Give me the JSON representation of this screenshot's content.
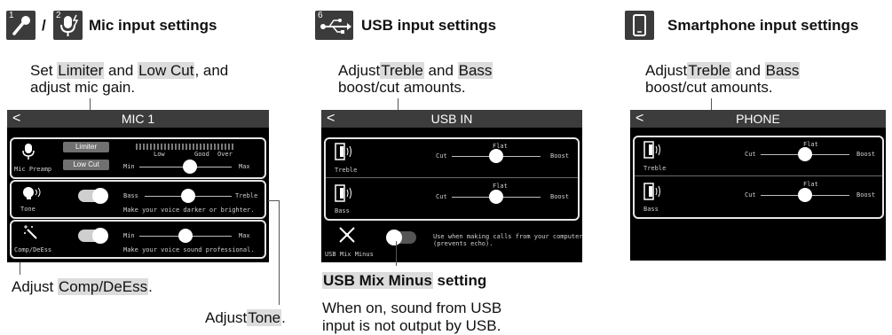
{
  "sections": {
    "mic": {
      "title": "Mic input settings",
      "separator": "/",
      "icon_numbers": [
        "1",
        "2"
      ],
      "icons": [
        "microphone-icon",
        "podcast-mic-icon"
      ],
      "desc_parts": [
        "Set ",
        "Limiter",
        " and ",
        "Low Cut",
        ", and",
        "adjust mic gain."
      ],
      "screen": {
        "title": "MIC 1",
        "back": "<",
        "preamp": {
          "label": "Mic Preamp",
          "limiter": "Limiter",
          "lowcut": "Low Cut",
          "meter_labels": [
            "Low",
            "Good",
            "Over"
          ],
          "min": "Min",
          "max": "Max",
          "gain_position": 0.55
        },
        "tone": {
          "label": "Tone",
          "left": "Bass",
          "right": "Treble",
          "hint": "Make your voice darker or brighter.",
          "toggle": "on",
          "position": 0.5
        },
        "comp": {
          "label": "Comp/DeEss",
          "left": "Min",
          "right": "Max",
          "hint": "Make your voice sound professional.",
          "toggle": "on",
          "position": 0.5
        }
      },
      "callout_comp": [
        "Adjust ",
        "Comp/DeEss",
        "."
      ],
      "callout_tone": [
        "Adjust",
        "Tone",
        "."
      ]
    },
    "usb": {
      "title": "USB input settings",
      "icon_number": "6",
      "icon": "usb-icon",
      "desc_parts": [
        "Adjust",
        "Treble",
        " and ",
        "Bass",
        "boost/cut amounts."
      ],
      "screen": {
        "title": "USB IN",
        "back": "<",
        "rows": [
          {
            "label": "Treble",
            "cut": "Cut",
            "flat": "Flat",
            "boost": "Boost",
            "position": 0.5
          },
          {
            "label": "Bass",
            "cut": "Cut",
            "flat": "Flat",
            "boost": "Boost",
            "position": 0.5
          }
        ],
        "mixminus": {
          "label": "USB Mix Minus",
          "hint_line1": "Use when making calls from your computer",
          "hint_line2": "(prevents echo).",
          "toggle": "off"
        }
      },
      "mixminus_title": "USB Mix Minus",
      "mixminus_title_suffix": " setting",
      "mixminus_desc": [
        "When on, sound from USB",
        "input is not output by USB."
      ]
    },
    "phone": {
      "title": "Smartphone input settings",
      "icon": "smartphone-icon",
      "desc_parts": [
        "Adjust",
        "Treble",
        " and ",
        "Bass",
        "boost/cut amounts."
      ],
      "screen": {
        "title": "PHONE",
        "back": "<",
        "rows": [
          {
            "label": "Treble",
            "cut": "Cut",
            "flat": "Flat",
            "boost": "Boost",
            "position": 0.5
          },
          {
            "label": "Bass",
            "cut": "Cut",
            "flat": "Flat",
            "boost": "Boost",
            "position": 0.5
          }
        ]
      }
    }
  }
}
